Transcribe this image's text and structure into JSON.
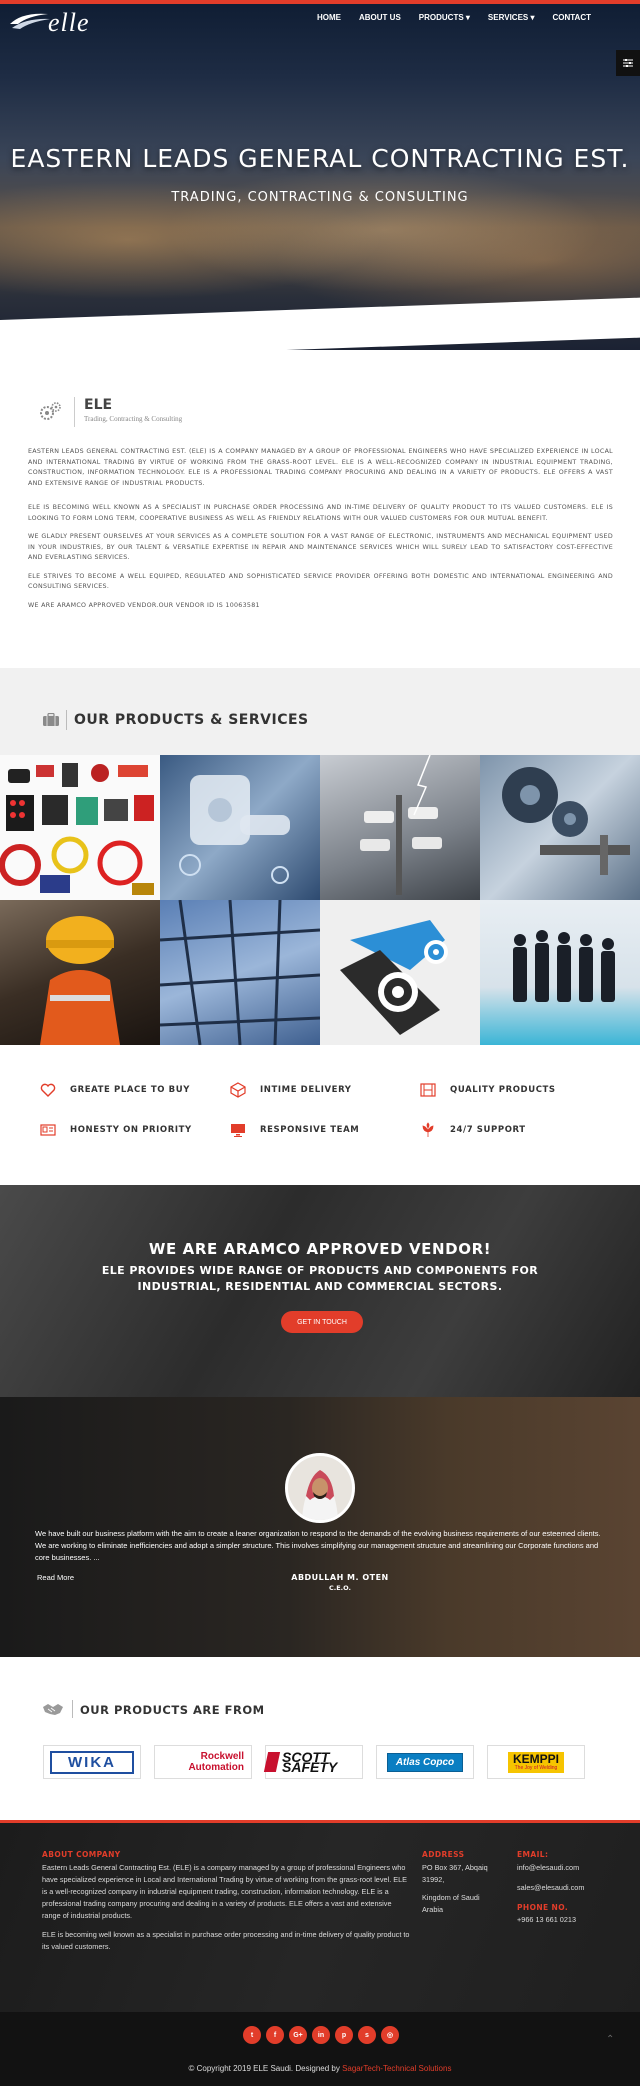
{
  "brand": {
    "logo_text": "elle"
  },
  "nav": {
    "items": [
      "HOME",
      "ABOUT US",
      "PRODUCTS ▾",
      "SERVICES ▾",
      "CONTACT"
    ]
  },
  "hero": {
    "title": "EASTERN LEADS GENERAL CONTRACTING EST.",
    "subtitle": "TRADING, CONTRACTING & CONSULTING"
  },
  "about": {
    "title": "ELE",
    "tagline": "Trading, Contracting & Consulting",
    "paragraphs": [
      "Eastern Leads General Contracting Est. (ELE) is a company managed by a group of professional engineers who have specialized experience in Local and International Trading by virtue of working from the grass-root level. ELE is a well-recognized company in industrial equipment trading, construction, information technology. ELE is a professional trading company procuring and dealing in a variety of products. ELE offers a vast and extensive range of industrial products.",
      "ELE is becoming well known as a specialist in purchase order processing and in-time delivery of quality product to its valued customers. ELE is looking to form long term, cooperative business as well as friendly relations with our valued customers for our mutual benefit.",
      "We gladly present ourselves at your services as a complete solution for a vast range of electronic, instruments and mechanical equipment used in your industries, by our talent & versatile expertise in repair and maintenance services which will surely lead to satisfactory cost-effective and everlasting services.",
      "ELE strives to become a well equiped, regulated and sophisticated service provider offering both domestic and international engineering and consulting services.",
      "We are Aramco Approved Vendor.Our Vendor ID is 10063581"
    ]
  },
  "products": {
    "title": "OUR PRODUCTS & SERVICES"
  },
  "features": [
    {
      "label": "GREATE PLACE TO BUY",
      "icon": "heart-icon"
    },
    {
      "label": "INTIME DELIVERY",
      "icon": "cube-icon"
    },
    {
      "label": "QUALITY PRODUCTS",
      "icon": "film-icon"
    },
    {
      "label": "HONESTY ON PRIORITY",
      "icon": "id-card-icon"
    },
    {
      "label": "RESPONSIVE TEAM",
      "icon": "monitor-icon"
    },
    {
      "label": "24/7 SUPPORT",
      "icon": "leaf-icon"
    }
  ],
  "vendor": {
    "title": "WE ARE ARAMCO APPROVED VENDOR!",
    "subtitle": "ELE PROVIDES WIDE RANGE OF PRODUCTS AND COMPONENTS FOR INDUSTRIAL, RESIDENTIAL AND COMMERCIAL SECTORS.",
    "cta": "GET IN TOUCH"
  },
  "testimonial": {
    "quote": "We have built our business platform with the aim to create a leaner organization to respond to the demands of the evolving business requirements of our esteemed clients. We are working to eliminate inefficiencies and adopt a simpler structure. This involves simplifying our management structure and streamlining our Corporate functions and core businesses. ...",
    "read_more": "Read More",
    "name": "ABDULLAH M. OTEN",
    "role": "C.E.O."
  },
  "brands": {
    "title": "OUR PRODUCTS ARE FROM",
    "items": [
      "WIKA",
      "Rockwell Automation",
      "SCOTT SAFETY",
      "Atlas Copco",
      "KEMPPI"
    ],
    "taglines": {
      "kemppi": "The Joy of Welding",
      "scott": "SAFETY"
    }
  },
  "footer": {
    "about_head": "ABOUT COMPANY",
    "about_p1": "Eastern Leads General Contracting Est. (ELE) is a company managed by a group of professional Engineers who have specialized experience in Local and International Trading by virtue of working from the grass-root level. ELE is a well-recognized company in industrial equipment trading, construction, information technology. ELE is a professional trading company procuring and dealing in a variety of products. ELE offers a vast and extensive range of industrial products.",
    "about_p2": "ELE is becoming well known as a specialist in purchase order processing and in-time delivery of quality product to its valued customers.",
    "address_head": "ADDRESS",
    "address_line1": "PO Box 367, Abqaiq",
    "address_line2": "31992,",
    "address_line3": "Kingdom of Saudi",
    "address_line4": "Arabia",
    "email_head": "EMAIL:",
    "email1": "info@elesaudi.com",
    "email2": "sales@elesaudi.com",
    "phone_head": "PHONE NO.",
    "phone": "+966 13 661 0213"
  },
  "socials": [
    "t",
    "f",
    "G+",
    "in",
    "p",
    "s",
    "◎"
  ],
  "copyright": {
    "text": "© Copyright 2019 ELE Saudi. Designed by ",
    "link": "SagarTech-Technical Solutions"
  },
  "colors": {
    "accent": "#e23d2a",
    "dark": "#1c1c1c"
  }
}
